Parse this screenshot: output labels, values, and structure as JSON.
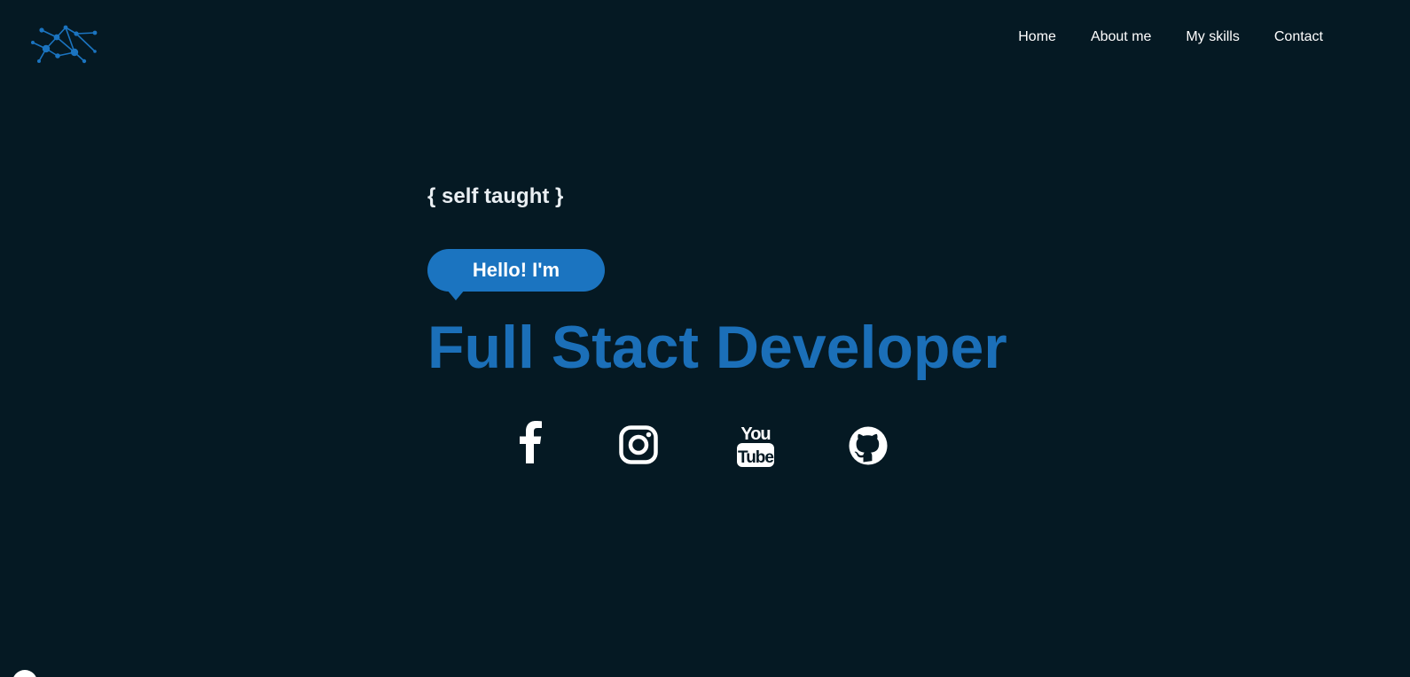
{
  "brand": {
    "logo_icon": "network-graph-icon",
    "accent_color": "#1b74c0"
  },
  "nav": {
    "items": [
      {
        "label": "Home"
      },
      {
        "label": "About me"
      },
      {
        "label": "My skills"
      },
      {
        "label": "Contact"
      }
    ]
  },
  "hero": {
    "tagline": "{ self taught }",
    "greeting": "Hello! I'm",
    "title": "Full Stact Developer"
  },
  "socials": [
    {
      "icon": "facebook-icon"
    },
    {
      "icon": "instagram-icon"
    },
    {
      "icon": "youtube-icon",
      "label_top": "You",
      "label_bottom": "Tube"
    },
    {
      "icon": "github-icon"
    }
  ],
  "colors": {
    "background": "#051923",
    "accent": "#1b74c0",
    "title": "#1b6fb8",
    "text": "#ffffff"
  }
}
